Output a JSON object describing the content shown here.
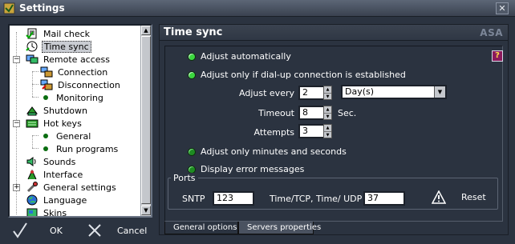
{
  "window": {
    "title": "Settings",
    "close_glyph": "✕"
  },
  "tree": {
    "items": [
      {
        "label": "Mail check",
        "icon": "mail-check-icon",
        "level": 0
      },
      {
        "label": "Time sync",
        "icon": "clock-icon",
        "level": 0,
        "selected": true
      },
      {
        "label": "Remote access",
        "icon": "network-icon",
        "level": 0,
        "expanded": true
      },
      {
        "label": "Connection",
        "icon": "connect-icon",
        "level": 1
      },
      {
        "label": "Disconnection",
        "icon": "disconnect-icon",
        "level": 1
      },
      {
        "label": "Monitoring",
        "icon": "dot-icon",
        "level": 1
      },
      {
        "label": "Shutdown",
        "icon": "shutdown-icon",
        "level": 0
      },
      {
        "label": "Hot keys",
        "icon": "keyboard-icon",
        "level": 0,
        "expanded": true
      },
      {
        "label": "General",
        "icon": "dot-icon",
        "level": 1
      },
      {
        "label": "Run programs",
        "icon": "dot-icon",
        "level": 1
      },
      {
        "label": "Sounds",
        "icon": "speaker-icon",
        "level": 0
      },
      {
        "label": "Interface",
        "icon": "interface-icon",
        "level": 0
      },
      {
        "label": "General settings",
        "icon": "tools-icon",
        "level": 0,
        "collapsed": true
      },
      {
        "label": "Language",
        "icon": "globe-icon",
        "level": 0
      },
      {
        "label": "Skins",
        "icon": "skins-icon",
        "level": 0
      }
    ]
  },
  "buttons": {
    "ok": "OK",
    "cancel": "Cancel"
  },
  "panel": {
    "title": "Time sync",
    "brand": "ASA",
    "help": "?",
    "options": {
      "adjust_auto": "Adjust automatically",
      "adjust_dialup": "Adjust only if dial-up connection is established",
      "adjust_minutes": "Adjust only minutes and seconds",
      "display_errors": "Display error messages"
    },
    "fields": {
      "adjust_every_label": "Adjust every",
      "adjust_every_value": "2",
      "unit_value": "Day(s)",
      "timeout_label": "Timeout",
      "timeout_value": "8",
      "timeout_unit": "Sec.",
      "attempts_label": "Attempts",
      "attempts_value": "3"
    },
    "ports": {
      "legend": "Ports",
      "sntp_label": "SNTP",
      "sntp_value": "123",
      "tcp_label": "Time/TCP, Time/ UDP",
      "tcp_value": "37",
      "reset_label": "Reset"
    },
    "tabs": [
      "General options",
      "Servers properties"
    ]
  },
  "colors": {
    "radio_on": "#3bd63f",
    "radio_off": "#1e8b22",
    "background": "#2b3340",
    "help": "#8c1a5c"
  }
}
